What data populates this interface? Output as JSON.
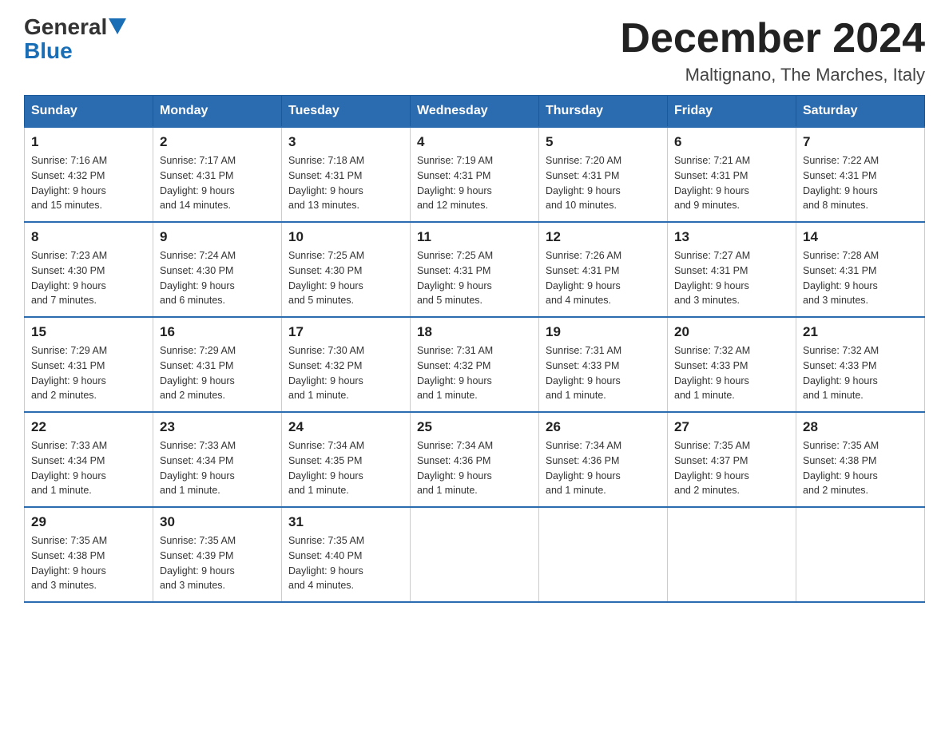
{
  "header": {
    "logo_general": "General",
    "logo_blue": "Blue",
    "month_title": "December 2024",
    "location": "Maltignano, The Marches, Italy"
  },
  "weekdays": [
    "Sunday",
    "Monday",
    "Tuesday",
    "Wednesday",
    "Thursday",
    "Friday",
    "Saturday"
  ],
  "weeks": [
    [
      {
        "day": "1",
        "sunrise": "7:16 AM",
        "sunset": "4:32 PM",
        "daylight": "9 hours and 15 minutes."
      },
      {
        "day": "2",
        "sunrise": "7:17 AM",
        "sunset": "4:31 PM",
        "daylight": "9 hours and 14 minutes."
      },
      {
        "day": "3",
        "sunrise": "7:18 AM",
        "sunset": "4:31 PM",
        "daylight": "9 hours and 13 minutes."
      },
      {
        "day": "4",
        "sunrise": "7:19 AM",
        "sunset": "4:31 PM",
        "daylight": "9 hours and 12 minutes."
      },
      {
        "day": "5",
        "sunrise": "7:20 AM",
        "sunset": "4:31 PM",
        "daylight": "9 hours and 10 minutes."
      },
      {
        "day": "6",
        "sunrise": "7:21 AM",
        "sunset": "4:31 PM",
        "daylight": "9 hours and 9 minutes."
      },
      {
        "day": "7",
        "sunrise": "7:22 AM",
        "sunset": "4:31 PM",
        "daylight": "9 hours and 8 minutes."
      }
    ],
    [
      {
        "day": "8",
        "sunrise": "7:23 AM",
        "sunset": "4:30 PM",
        "daylight": "9 hours and 7 minutes."
      },
      {
        "day": "9",
        "sunrise": "7:24 AM",
        "sunset": "4:30 PM",
        "daylight": "9 hours and 6 minutes."
      },
      {
        "day": "10",
        "sunrise": "7:25 AM",
        "sunset": "4:30 PM",
        "daylight": "9 hours and 5 minutes."
      },
      {
        "day": "11",
        "sunrise": "7:25 AM",
        "sunset": "4:31 PM",
        "daylight": "9 hours and 5 minutes."
      },
      {
        "day": "12",
        "sunrise": "7:26 AM",
        "sunset": "4:31 PM",
        "daylight": "9 hours and 4 minutes."
      },
      {
        "day": "13",
        "sunrise": "7:27 AM",
        "sunset": "4:31 PM",
        "daylight": "9 hours and 3 minutes."
      },
      {
        "day": "14",
        "sunrise": "7:28 AM",
        "sunset": "4:31 PM",
        "daylight": "9 hours and 3 minutes."
      }
    ],
    [
      {
        "day": "15",
        "sunrise": "7:29 AM",
        "sunset": "4:31 PM",
        "daylight": "9 hours and 2 minutes."
      },
      {
        "day": "16",
        "sunrise": "7:29 AM",
        "sunset": "4:31 PM",
        "daylight": "9 hours and 2 minutes."
      },
      {
        "day": "17",
        "sunrise": "7:30 AM",
        "sunset": "4:32 PM",
        "daylight": "9 hours and 1 minute."
      },
      {
        "day": "18",
        "sunrise": "7:31 AM",
        "sunset": "4:32 PM",
        "daylight": "9 hours and 1 minute."
      },
      {
        "day": "19",
        "sunrise": "7:31 AM",
        "sunset": "4:33 PM",
        "daylight": "9 hours and 1 minute."
      },
      {
        "day": "20",
        "sunrise": "7:32 AM",
        "sunset": "4:33 PM",
        "daylight": "9 hours and 1 minute."
      },
      {
        "day": "21",
        "sunrise": "7:32 AM",
        "sunset": "4:33 PM",
        "daylight": "9 hours and 1 minute."
      }
    ],
    [
      {
        "day": "22",
        "sunrise": "7:33 AM",
        "sunset": "4:34 PM",
        "daylight": "9 hours and 1 minute."
      },
      {
        "day": "23",
        "sunrise": "7:33 AM",
        "sunset": "4:34 PM",
        "daylight": "9 hours and 1 minute."
      },
      {
        "day": "24",
        "sunrise": "7:34 AM",
        "sunset": "4:35 PM",
        "daylight": "9 hours and 1 minute."
      },
      {
        "day": "25",
        "sunrise": "7:34 AM",
        "sunset": "4:36 PM",
        "daylight": "9 hours and 1 minute."
      },
      {
        "day": "26",
        "sunrise": "7:34 AM",
        "sunset": "4:36 PM",
        "daylight": "9 hours and 1 minute."
      },
      {
        "day": "27",
        "sunrise": "7:35 AM",
        "sunset": "4:37 PM",
        "daylight": "9 hours and 2 minutes."
      },
      {
        "day": "28",
        "sunrise": "7:35 AM",
        "sunset": "4:38 PM",
        "daylight": "9 hours and 2 minutes."
      }
    ],
    [
      {
        "day": "29",
        "sunrise": "7:35 AM",
        "sunset": "4:38 PM",
        "daylight": "9 hours and 3 minutes."
      },
      {
        "day": "30",
        "sunrise": "7:35 AM",
        "sunset": "4:39 PM",
        "daylight": "9 hours and 3 minutes."
      },
      {
        "day": "31",
        "sunrise": "7:35 AM",
        "sunset": "4:40 PM",
        "daylight": "9 hours and 4 minutes."
      },
      null,
      null,
      null,
      null
    ]
  ],
  "labels": {
    "sunrise": "Sunrise:",
    "sunset": "Sunset:",
    "daylight": "Daylight:"
  }
}
